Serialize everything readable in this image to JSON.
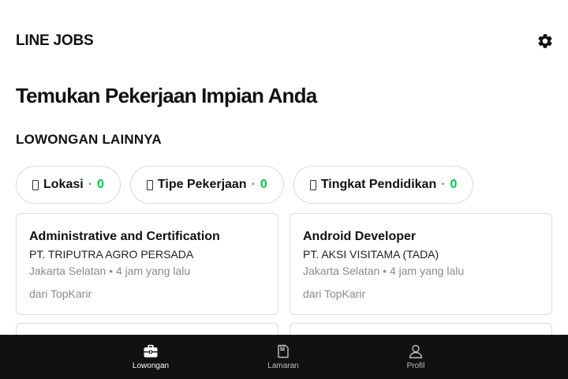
{
  "header": {
    "logo": "LINE JOBS",
    "settings_icon": "gear-icon"
  },
  "headline": "Temukan Pekerjaan Impian Anda",
  "section_title": "LOWONGAN LAINNYA",
  "filters": [
    {
      "label": "Lokasi",
      "separator": "·",
      "count": "0"
    },
    {
      "label": "Tipe Pekerjaan",
      "separator": "·",
      "count": "0"
    },
    {
      "label": "Tingkat Pendidikan",
      "separator": "·",
      "count": "0"
    }
  ],
  "jobs": [
    {
      "title": "Administrative and Certification",
      "company": "PT. TRIPUTRA AGRO PERSADA",
      "meta": "Jakarta Selatan • 4 jam yang lalu",
      "source": "dari TopKarir"
    },
    {
      "title": "Android Developer",
      "company": "PT. AKSI VISITAMA (TADA)",
      "meta": "Jakarta Selatan • 4 jam yang lalu",
      "source": "dari TopKarir"
    }
  ],
  "bottom_nav": [
    {
      "label": "Lowongan",
      "icon": "briefcase-icon",
      "active": true
    },
    {
      "label": "Lamaran",
      "icon": "document-icon",
      "active": false
    },
    {
      "label": "Profil",
      "icon": "person-icon",
      "active": false
    }
  ],
  "colors": {
    "accent": "#06c755",
    "nav_bg": "#111111",
    "border": "#dcdcdc"
  }
}
